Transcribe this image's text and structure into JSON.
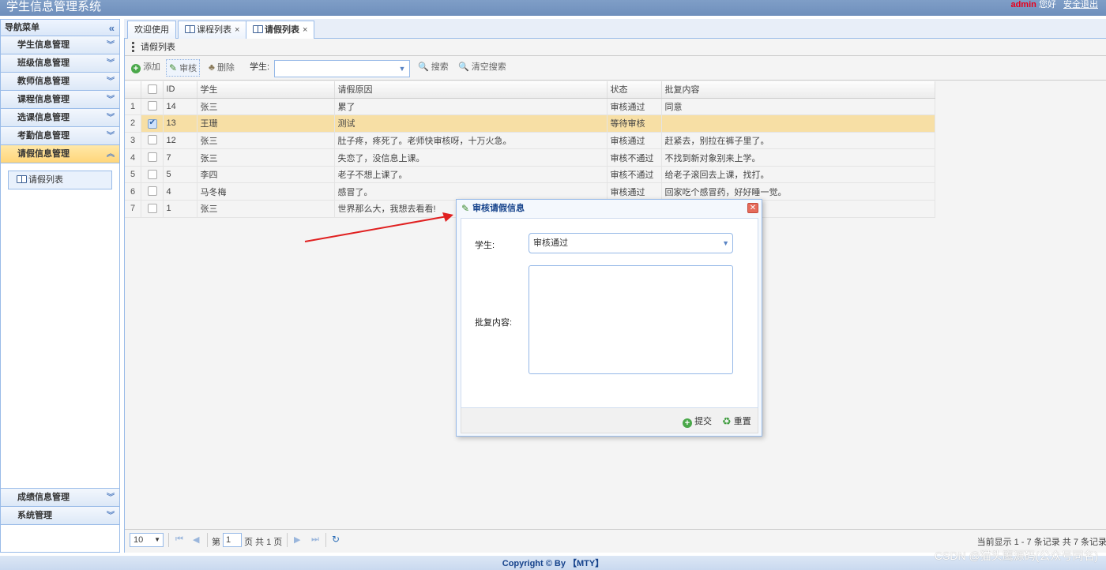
{
  "header": {
    "title": "学生信息管理系统",
    "user": "admin",
    "greeting": "您好",
    "logout": "安全退出"
  },
  "sidebar": {
    "title": "导航菜单",
    "items": [
      {
        "label": "学生信息管理"
      },
      {
        "label": "班级信息管理"
      },
      {
        "label": "教师信息管理"
      },
      {
        "label": "课程信息管理"
      },
      {
        "label": "选课信息管理"
      },
      {
        "label": "考勤信息管理"
      },
      {
        "label": "请假信息管理"
      }
    ],
    "sub_link": "请假列表",
    "bottom_items": [
      {
        "label": "成绩信息管理"
      },
      {
        "label": "系统管理"
      }
    ]
  },
  "tabs": [
    {
      "label": "欢迎使用"
    },
    {
      "label": "课程列表"
    },
    {
      "label": "请假列表"
    }
  ],
  "panel": {
    "title": "请假列表"
  },
  "toolbar": {
    "add": "添加",
    "audit": "审核",
    "delete": "删除",
    "student_label": "学生:",
    "student_value": "",
    "search": "搜索",
    "clear": "清空搜索"
  },
  "grid": {
    "columns": [
      "ID",
      "学生",
      "请假原因",
      "状态",
      "批复内容"
    ],
    "rows": [
      {
        "n": "1",
        "id": "14",
        "student": "张三",
        "reason": "累了",
        "status": "审核通过",
        "reply": "同意"
      },
      {
        "n": "2",
        "id": "13",
        "student": "王珊",
        "reason": "测试",
        "status": "等待审核",
        "reply": ""
      },
      {
        "n": "3",
        "id": "12",
        "student": "张三",
        "reason": "肚子疼，疼死了。老师快审核呀，十万火急。",
        "status": "审核通过",
        "reply": "赶紧去，别拉在裤子里了。"
      },
      {
        "n": "4",
        "id": "7",
        "student": "张三",
        "reason": "失恋了，没信息上课。",
        "status": "审核不通过",
        "reply": "不找到新对象别来上学。"
      },
      {
        "n": "5",
        "id": "5",
        "student": "李四",
        "reason": "老子不想上课了。",
        "status": "审核不通过",
        "reply": "给老子滚回去上课，找打。"
      },
      {
        "n": "6",
        "id": "4",
        "student": "马冬梅",
        "reason": "感冒了。",
        "status": "审核通过",
        "reply": "回家吃个感冒药，好好睡一觉。"
      },
      {
        "n": "7",
        "id": "1",
        "student": "张三",
        "reason": "世界那么大，我想去看看!",
        "status": "",
        "reply": ""
      }
    ]
  },
  "pager": {
    "page_size": "10",
    "page_prefix": "第",
    "page_value": "1",
    "page_suffix": "页 共 1 页",
    "info": "当前显示 1 - 7 条记录 共 7 条记录"
  },
  "modal": {
    "title": "审核请假信息",
    "student_label": "学生:",
    "status_value": "审核通过",
    "reply_label": "批复内容:",
    "submit": "提交",
    "reset": "重置"
  },
  "footer": {
    "text": "Copyright © By 【MTY】"
  },
  "watermark": "CSDN @猫头鹰源码(公众号同名)"
}
